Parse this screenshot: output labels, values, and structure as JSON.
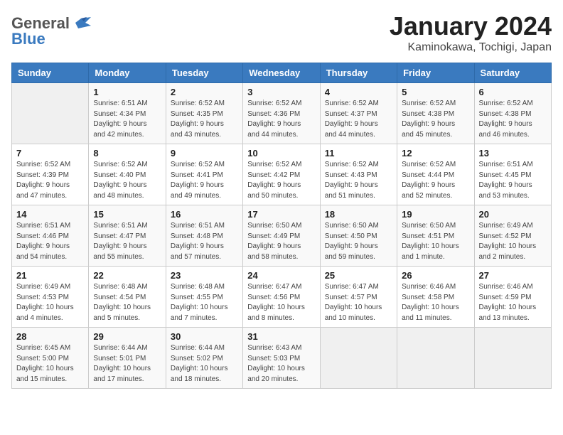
{
  "header": {
    "logo_general": "General",
    "logo_blue": "Blue",
    "month_year": "January 2024",
    "location": "Kaminokawa, Tochigi, Japan"
  },
  "columns": [
    "Sunday",
    "Monday",
    "Tuesday",
    "Wednesday",
    "Thursday",
    "Friday",
    "Saturday"
  ],
  "weeks": [
    [
      {
        "day": "",
        "info": ""
      },
      {
        "day": "1",
        "info": "Sunrise: 6:51 AM\nSunset: 4:34 PM\nDaylight: 9 hours\nand 42 minutes."
      },
      {
        "day": "2",
        "info": "Sunrise: 6:52 AM\nSunset: 4:35 PM\nDaylight: 9 hours\nand 43 minutes."
      },
      {
        "day": "3",
        "info": "Sunrise: 6:52 AM\nSunset: 4:36 PM\nDaylight: 9 hours\nand 44 minutes."
      },
      {
        "day": "4",
        "info": "Sunrise: 6:52 AM\nSunset: 4:37 PM\nDaylight: 9 hours\nand 44 minutes."
      },
      {
        "day": "5",
        "info": "Sunrise: 6:52 AM\nSunset: 4:38 PM\nDaylight: 9 hours\nand 45 minutes."
      },
      {
        "day": "6",
        "info": "Sunrise: 6:52 AM\nSunset: 4:38 PM\nDaylight: 9 hours\nand 46 minutes."
      }
    ],
    [
      {
        "day": "7",
        "info": "Sunrise: 6:52 AM\nSunset: 4:39 PM\nDaylight: 9 hours\nand 47 minutes."
      },
      {
        "day": "8",
        "info": "Sunrise: 6:52 AM\nSunset: 4:40 PM\nDaylight: 9 hours\nand 48 minutes."
      },
      {
        "day": "9",
        "info": "Sunrise: 6:52 AM\nSunset: 4:41 PM\nDaylight: 9 hours\nand 49 minutes."
      },
      {
        "day": "10",
        "info": "Sunrise: 6:52 AM\nSunset: 4:42 PM\nDaylight: 9 hours\nand 50 minutes."
      },
      {
        "day": "11",
        "info": "Sunrise: 6:52 AM\nSunset: 4:43 PM\nDaylight: 9 hours\nand 51 minutes."
      },
      {
        "day": "12",
        "info": "Sunrise: 6:52 AM\nSunset: 4:44 PM\nDaylight: 9 hours\nand 52 minutes."
      },
      {
        "day": "13",
        "info": "Sunrise: 6:51 AM\nSunset: 4:45 PM\nDaylight: 9 hours\nand 53 minutes."
      }
    ],
    [
      {
        "day": "14",
        "info": "Sunrise: 6:51 AM\nSunset: 4:46 PM\nDaylight: 9 hours\nand 54 minutes."
      },
      {
        "day": "15",
        "info": "Sunrise: 6:51 AM\nSunset: 4:47 PM\nDaylight: 9 hours\nand 55 minutes."
      },
      {
        "day": "16",
        "info": "Sunrise: 6:51 AM\nSunset: 4:48 PM\nDaylight: 9 hours\nand 57 minutes."
      },
      {
        "day": "17",
        "info": "Sunrise: 6:50 AM\nSunset: 4:49 PM\nDaylight: 9 hours\nand 58 minutes."
      },
      {
        "day": "18",
        "info": "Sunrise: 6:50 AM\nSunset: 4:50 PM\nDaylight: 9 hours\nand 59 minutes."
      },
      {
        "day": "19",
        "info": "Sunrise: 6:50 AM\nSunset: 4:51 PM\nDaylight: 10 hours\nand 1 minute."
      },
      {
        "day": "20",
        "info": "Sunrise: 6:49 AM\nSunset: 4:52 PM\nDaylight: 10 hours\nand 2 minutes."
      }
    ],
    [
      {
        "day": "21",
        "info": "Sunrise: 6:49 AM\nSunset: 4:53 PM\nDaylight: 10 hours\nand 4 minutes."
      },
      {
        "day": "22",
        "info": "Sunrise: 6:48 AM\nSunset: 4:54 PM\nDaylight: 10 hours\nand 5 minutes."
      },
      {
        "day": "23",
        "info": "Sunrise: 6:48 AM\nSunset: 4:55 PM\nDaylight: 10 hours\nand 7 minutes."
      },
      {
        "day": "24",
        "info": "Sunrise: 6:47 AM\nSunset: 4:56 PM\nDaylight: 10 hours\nand 8 minutes."
      },
      {
        "day": "25",
        "info": "Sunrise: 6:47 AM\nSunset: 4:57 PM\nDaylight: 10 hours\nand 10 minutes."
      },
      {
        "day": "26",
        "info": "Sunrise: 6:46 AM\nSunset: 4:58 PM\nDaylight: 10 hours\nand 11 minutes."
      },
      {
        "day": "27",
        "info": "Sunrise: 6:46 AM\nSunset: 4:59 PM\nDaylight: 10 hours\nand 13 minutes."
      }
    ],
    [
      {
        "day": "28",
        "info": "Sunrise: 6:45 AM\nSunset: 5:00 PM\nDaylight: 10 hours\nand 15 minutes."
      },
      {
        "day": "29",
        "info": "Sunrise: 6:44 AM\nSunset: 5:01 PM\nDaylight: 10 hours\nand 17 minutes."
      },
      {
        "day": "30",
        "info": "Sunrise: 6:44 AM\nSunset: 5:02 PM\nDaylight: 10 hours\nand 18 minutes."
      },
      {
        "day": "31",
        "info": "Sunrise: 6:43 AM\nSunset: 5:03 PM\nDaylight: 10 hours\nand 20 minutes."
      },
      {
        "day": "",
        "info": ""
      },
      {
        "day": "",
        "info": ""
      },
      {
        "day": "",
        "info": ""
      }
    ]
  ]
}
